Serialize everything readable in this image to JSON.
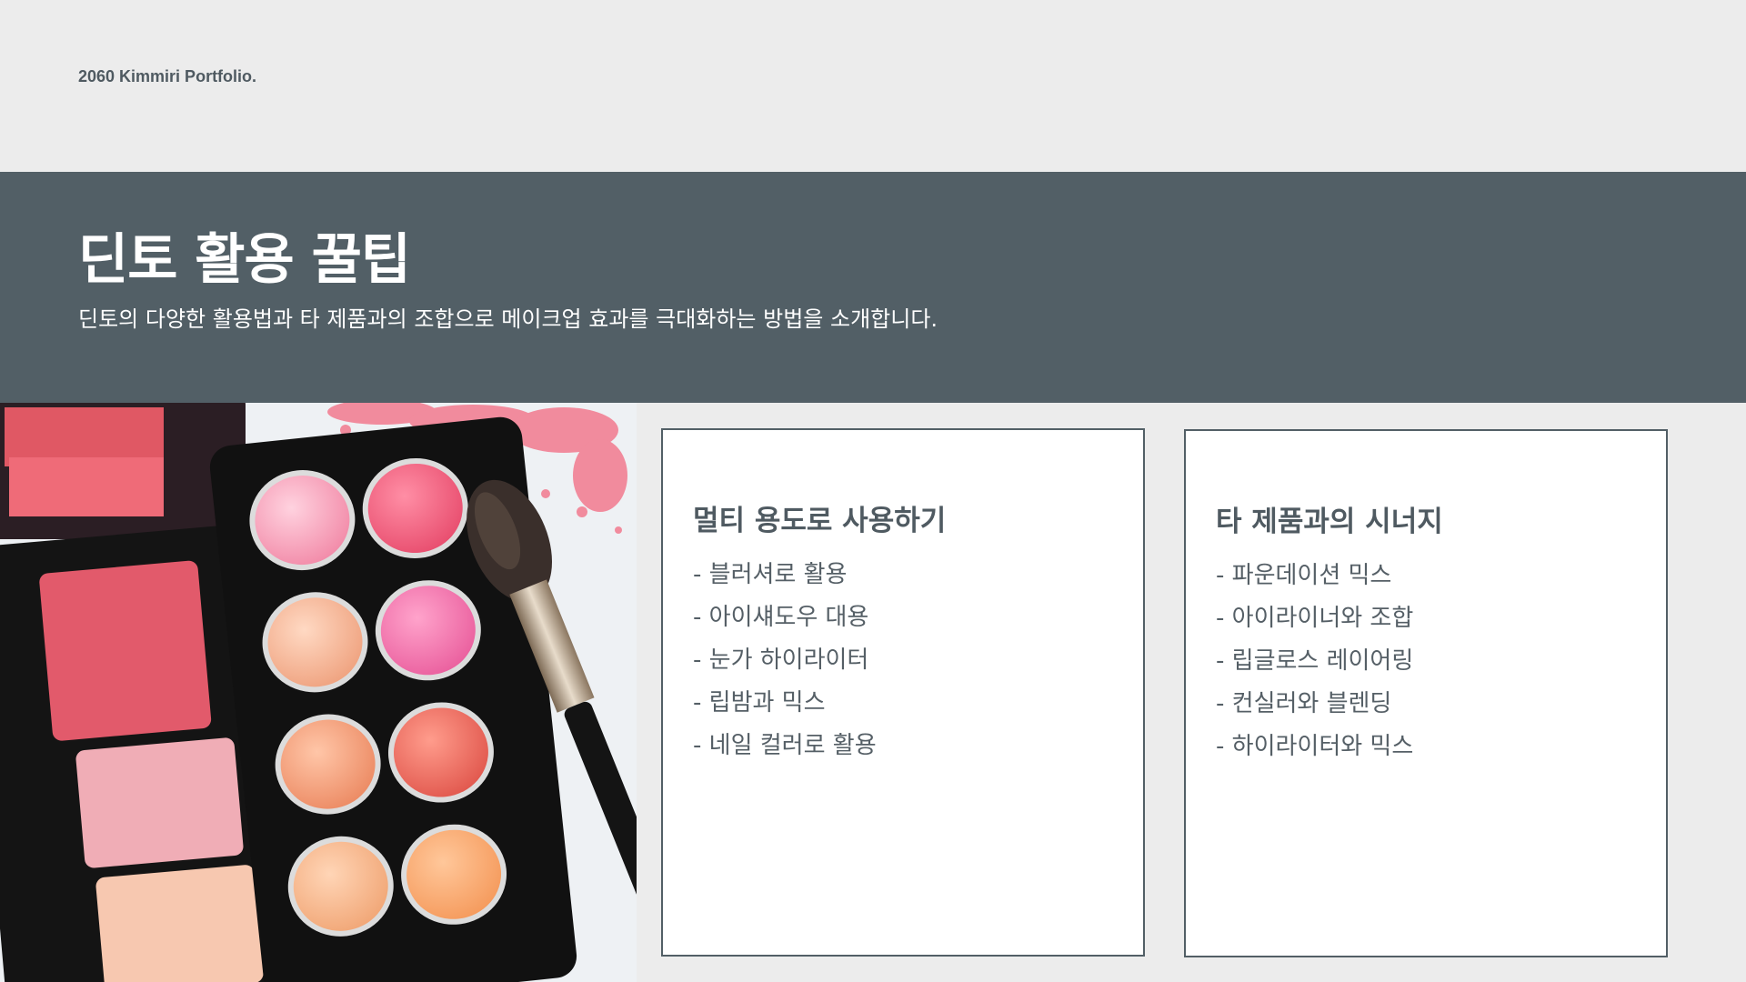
{
  "brand": "2060 Kimmiri Portfolio.",
  "header": {
    "title": "딘토 활용 꿀팁",
    "subtitle": "딘토의 다양한 활용법과 타 제품과의 조합으로 메이크업 효과를 극대화하는 방법을 소개합니다."
  },
  "cards": [
    {
      "title": "멀티 용도로 사용하기",
      "items": [
        "- 블러셔로 활용",
        "- 아이섀도우 대용",
        "- 눈가 하이라이터",
        "- 립밤과 믹스",
        "- 네일 컬러로 활용"
      ]
    },
    {
      "title": "타 제품과의 시너지",
      "items": [
        "- 파운데이션 믹스",
        "- 아이라이너와 조합",
        "- 립글로스 레이어링",
        "- 컨실러와 블렌딩",
        "- 하이라이터와 믹스"
      ]
    }
  ],
  "colors": {
    "header_bg": "#525f66",
    "page_bg": "#ececec",
    "card_border": "#525f66",
    "text_dark": "#4f5a61"
  },
  "image": {
    "subject": "makeup-palette-photo"
  }
}
